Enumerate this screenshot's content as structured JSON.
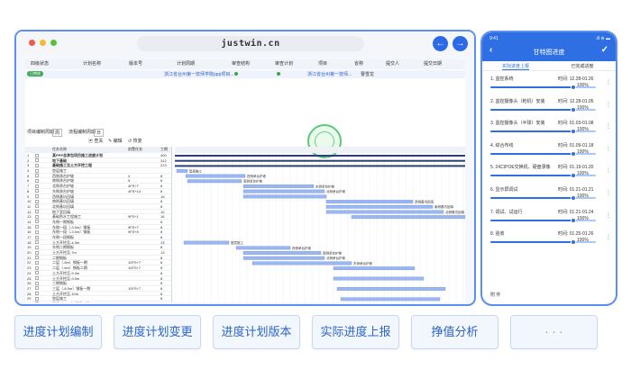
{
  "window": {
    "url": "justwin.cn",
    "back_icon": "arrow-left-icon",
    "forward_icon": "arrow-right-icon",
    "dot_colors": [
      "#ed5a4f",
      "#f5bb31",
      "#56c141"
    ]
  },
  "top_table": {
    "headers": [
      "四级状态",
      "计划名称",
      "版本号",
      "计划周期",
      "审查结构",
      "审查计划",
      "项目",
      "省称",
      "提交人",
      "提交日期"
    ],
    "status_badge": "已审核",
    "row_text": [
      "浙江省台州第一技师学院ppp项目...",
      "浙江省台州第一技师...",
      "曹雪龙"
    ]
  },
  "toolbar": {
    "items": [
      "项目编制周期",
      "周",
      "流程编制周期",
      "日"
    ],
    "actions": [
      "查关",
      "编辑",
      "恢复"
    ]
  },
  "grid": {
    "headers": [
      "",
      "",
      "任务名称",
      "前置任务",
      "工期"
    ],
    "rows": [
      [
        "1",
        "",
        "某PPP总承包项目施工进度计划",
        "",
        "400"
      ],
      [
        "2",
        "",
        "地下基础",
        "",
        "312"
      ],
      [
        "3",
        "",
        "基础施工及土方开挖工程",
        "",
        "223"
      ],
      [
        "4",
        "",
        "垫层施工",
        "",
        ""
      ],
      [
        "5",
        "",
        "西侧承台护坡",
        "4",
        "8"
      ],
      [
        "6",
        "",
        "南侧承台护坡",
        "5",
        "8"
      ],
      [
        "7",
        "",
        "北侧承台护坡",
        "4FS+7",
        "8"
      ],
      [
        "8",
        "",
        "东侧承台护坡",
        "4FS+14",
        "8"
      ],
      [
        "9",
        "",
        "西侧基坑回填",
        "",
        "15"
      ],
      [
        "10",
        "",
        "南侧基坑回填",
        "",
        "8"
      ],
      [
        "11",
        "",
        "北侧基坑回填",
        "",
        "8"
      ],
      [
        "12",
        "",
        "地下室回填",
        "",
        "10"
      ],
      [
        "13",
        "",
        "基础防水工程施工",
        "9FS+1",
        "16"
      ],
      [
        "14",
        "",
        "东侧一期钢板",
        "",
        "8"
      ],
      [
        "15",
        "",
        "东侧一段（-3.5m）钢板",
        "9FS+7",
        "8"
      ],
      [
        "16",
        "",
        "东侧一段（-3.5m）钢板",
        "9FS+5",
        "8"
      ],
      [
        "17",
        "",
        "东侧一段钢板",
        "",
        "8"
      ],
      [
        "18",
        "",
        "土方开挖至-4.3m",
        "",
        "13"
      ],
      [
        "19",
        "",
        "东侧二期钢板",
        "",
        "8"
      ],
      [
        "20",
        "",
        "土方开挖至-7m",
        "",
        "13"
      ],
      [
        "21",
        "",
        "二期钢板",
        "",
        "8"
      ],
      [
        "22",
        "",
        "二层（-6m）钢板一期",
        "10FS+7",
        "8"
      ],
      [
        "23",
        "",
        "二层（-6m）钢板二期",
        "10FS+7",
        "8"
      ],
      [
        "24",
        "",
        "土方开挖至-9.3m",
        "",
        "8"
      ],
      [
        "25",
        "",
        "土方开挖至-9.5m",
        "",
        "8"
      ],
      [
        "26",
        "",
        "三期钢板",
        "",
        "8"
      ],
      [
        "27",
        "",
        "三层（-8.5m）钢板一期",
        "10FS+7",
        "8"
      ],
      [
        "28",
        "",
        "土方开挖至-10m",
        "",
        "8"
      ],
      [
        "29",
        "",
        "垫层施工",
        "",
        "8"
      ],
      [
        "30",
        "",
        "四层（-11m）钢板一期",
        "27FS+7",
        "8"
      ],
      [
        "31",
        "",
        "3.5层土方开挖至 -14.5",
        "",
        "8"
      ],
      [
        "32",
        "",
        "底板施工",
        "",
        "8"
      ]
    ]
  },
  "gantt": {
    "labels": [
      "垫层施工",
      "西侧承台护坡",
      "南侧承台护坡",
      "东侧承台护坡",
      "北侧承台护坡",
      "西侧基坑回填",
      "南侧基坑回填",
      "北侧基坑回填",
      "垫层施工",
      "西侧承台护坡",
      "南侧承台护坡",
      "北侧承台护坡",
      "东侧承台护坡"
    ]
  },
  "phone": {
    "time": "9:41",
    "signal": "ıll ⊜ ▬",
    "title": "甘特图进度",
    "back_icon": "chevron-left-icon",
    "confirm_icon": "check-icon",
    "tabs": [
      "实际进度上报",
      "已完成进度"
    ],
    "items": [
      {
        "name": "1. 监控系统",
        "time": "时间: 12.28-01.26",
        "pct": "100%",
        "value": 1.0
      },
      {
        "name": "2. 监控摄像头（枪机）安装",
        "time": "时间: 12.28-01.05",
        "pct": "100%",
        "value": 1.0
      },
      {
        "name": "3. 监控摄像头（半球）安装",
        "time": "时间: 01.03-01.08",
        "pct": "100%",
        "value": 1.0
      },
      {
        "name": "4. 综合布线",
        "time": "时间: 01.09-01.18",
        "pct": "100%",
        "value": 1.0
      },
      {
        "name": "5. 24口POE交换机、硬盘录像",
        "time": "时间: 01.19-01.20",
        "pct": "100%",
        "value": 1.0
      },
      {
        "name": "6. 显示屏调试",
        "time": "时间: 01.21-01.21",
        "pct": "100%",
        "value": 1.0
      },
      {
        "name": "7. 调试、试运行",
        "time": "时间: 01.21-01.24",
        "pct": "100%",
        "value": 1.0
      },
      {
        "name": "8. 验收",
        "time": "时间: 01.25-01.26",
        "pct": "100%",
        "value": 1.0
      }
    ],
    "footer": "附 件"
  },
  "buttons": [
    "进度计划编制",
    "进度计划变更",
    "进度计划版本",
    "实际进度上报",
    "挣值分析",
    "· · ·"
  ],
  "colors": {
    "accent": "#2e6fe4",
    "button_text": "#2c64c8",
    "bar": "#9bb7f2"
  }
}
